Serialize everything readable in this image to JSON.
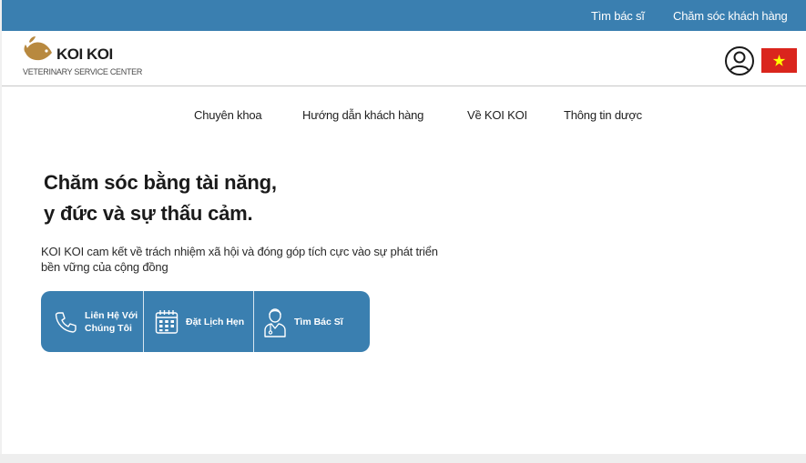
{
  "top_bar": {
    "links": [
      "Tìm bác sĩ",
      "Chăm sóc khách hàng"
    ],
    "background": "#3a7fb0"
  },
  "header": {
    "brand": "KOI KOI",
    "tagline": "VETERINARY SERVICE CENTER",
    "logo_icon": "fish-logo-icon",
    "user_icon": "user-circle-icon",
    "language_flag": "vietnam-flag-icon"
  },
  "nav": {
    "items": [
      "Chuyên khoa",
      "Hướng dẫn khách hàng",
      "Về KOI KOI",
      "Thông tin dược"
    ]
  },
  "hero": {
    "title_line1": "Chăm sóc bằng tài năng,",
    "title_line2": "y đức và sự thấu cảm.",
    "description": "KOI KOI cam kết về trách nhiệm xã hội và đóng góp tích cực vào sự phát triển bền vững của cộng đồng"
  },
  "cta": {
    "buttons": [
      {
        "label": "Liên Hệ Với Chúng Tôi",
        "icon": "phone-icon"
      },
      {
        "label": "Đặt Lịch Hẹn",
        "icon": "calendar-icon"
      },
      {
        "label": "Tìm Bác Sĩ",
        "icon": "doctor-icon"
      }
    ],
    "background": "#3a7fb0"
  }
}
